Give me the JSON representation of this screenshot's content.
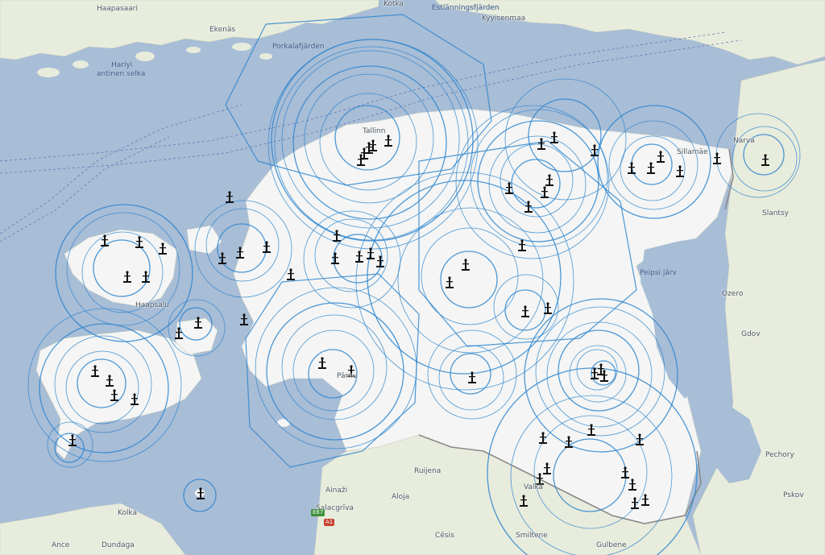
{
  "colors": {
    "sea": "#a8bdd6",
    "land_estonia": "#f4f5f4",
    "land_neighbor": "#e8ecdc",
    "forest": "#d3e3c4",
    "coverage": "#2f86cf",
    "border": "#8a8a8a"
  },
  "labels": {
    "haapasaari": "Haapasaari",
    "eastern_gulf": "Ekenäs",
    "kotka": "Kotka",
    "porkala": "Porkalafjärden",
    "hamina": "Estlänningsfjärden",
    "pyhtaa": "Kyyisenmaa",
    "hariyi": "Hariyi",
    "antinen_selka": "antinen selka",
    "tallinn": "Tallinn",
    "narva": "Narva",
    "peipsi": "Peipsi järv",
    "parnu": "Pärnu",
    "haapsalu": "Haapsalu",
    "riga_region": "Ruijena",
    "valka": "Valka",
    "aloja": "Aloja",
    "salacgriva": "Salacgrīva",
    "ainazi": "Ainaži",
    "cesis": "Cēsis",
    "smiltene": "Smiltene",
    "gulbene": "Gulbene",
    "ance": "Ance",
    "dundaga": "Dundaga",
    "pskov": "Pskov",
    "kolka": "Kolka",
    "sillamae": "Sillamäe",
    "kingisepp": "Slantsy",
    "ozero": "Ozero",
    "gdov": "Gdov",
    "pechory": "Pechory",
    "road_a1": "A1",
    "road_e67": "E67"
  },
  "icons": {
    "transmitter": "radio-tower-icon"
  },
  "transmitters_count": 58
}
